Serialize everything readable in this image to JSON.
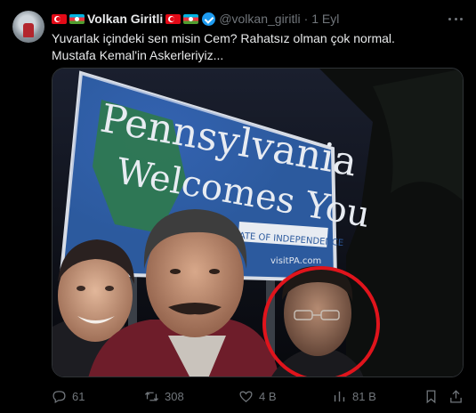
{
  "author": {
    "name": "Volkan Giritli",
    "handle": "@volkan_giritli",
    "date": "1 Eyl",
    "separator": "·"
  },
  "tweet": {
    "text": "Yuvarlak içindeki sen misin Cem? Rahatsız olman çok normal. Mustafa Kemal'in Askerleriyiz..."
  },
  "sign": {
    "line1": "Pennsylvania",
    "line2": "Welcomes You",
    "tagline": "STATE OF INDEPENDENCE",
    "url": "visitPA.com"
  },
  "actions": {
    "replies": "61",
    "retweets": "308",
    "likes": "4 B",
    "views": "81 B"
  },
  "colors": {
    "accent": "#1d9bf0",
    "sign_blue": "#2c5a9e",
    "circle": "#e0141c"
  },
  "icons": [
    "turkey-flag-icon",
    "azerbaijan-flag-icon",
    "verified-badge-icon",
    "more-icon",
    "reply-icon",
    "retweet-icon",
    "like-icon",
    "views-icon",
    "bookmark-icon",
    "share-icon"
  ]
}
